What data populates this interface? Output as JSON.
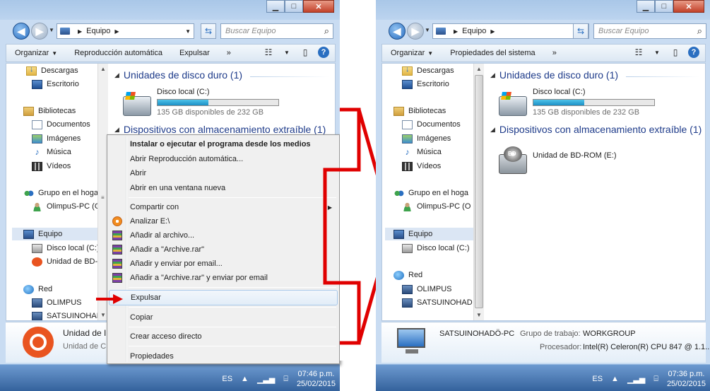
{
  "left_window": {
    "address": {
      "location": "Equipo"
    },
    "search_placeholder": "Buscar Equipo",
    "toolbar": {
      "organize": "Organizar",
      "autoplay": "Reproducción automática",
      "eject": "Expulsar",
      "more": "»"
    },
    "nav": {
      "downloads": "Descargas",
      "desktop": "Escritorio",
      "libraries": "Bibliotecas",
      "documents": "Documentos",
      "images": "Imágenes",
      "music": "Música",
      "videos": "Vídeos",
      "homegroup": "Grupo en el hoga",
      "user": "OlimpuS-PC (O",
      "computer": "Equipo",
      "local_disk": "Disco local (C:)",
      "bd_drive": "Unidad de BD-R",
      "network": "Red",
      "net1": "OLIMPUS",
      "net2": "SATSUINOHAD"
    },
    "groups": {
      "hard_disks": "Unidades de disco duro (1)",
      "removable": "Dispositivos con almacenamiento extraíble (1)"
    },
    "local_disk": {
      "name": "Disco local (C:)",
      "free": "135 GB disponibles de 232 GB",
      "used_fraction": 0.42
    },
    "details": {
      "name": "Unidad de I",
      "type": "Unidad de CI"
    },
    "context_menu": {
      "install": "Instalar o ejecutar el programa desde los medios",
      "autoplay": "Abrir Reproducción automática...",
      "open": "Abrir",
      "open_new": "Abrir en una ventana nueva",
      "share": "Compartir con",
      "scan": "Analizar E:\\",
      "add_archive": "Añadir al archivo...",
      "add_rar": "Añadir a \"Archive.rar\"",
      "add_email": "Añadir y enviar por email...",
      "add_rar_email": "Añadir a \"Archive.rar\" y enviar por email",
      "eject": "Expulsar",
      "copy": "Copiar",
      "shortcut": "Crear acceso directo",
      "properties": "Propiedades"
    },
    "tray": {
      "lang": "ES",
      "time": "07:46 p.m.",
      "date": "25/02/2015"
    }
  },
  "right_window": {
    "address": {
      "location": "Equipo"
    },
    "search_placeholder": "Buscar Equipo",
    "toolbar": {
      "organize": "Organizar",
      "properties": "Propiedades del sistema",
      "more": "»"
    },
    "nav": {
      "downloads": "Descargas",
      "desktop": "Escritorio",
      "libraries": "Bibliotecas",
      "documents": "Documentos",
      "images": "Imágenes",
      "music": "Música",
      "videos": "Vídeos",
      "homegroup": "Grupo en el hoga",
      "user": "OlimpuS-PC (O",
      "computer": "Equipo",
      "local_disk": "Disco local (C:)",
      "network": "Red",
      "net1": "OLIMPUS",
      "net2": "SATSUINOHAD"
    },
    "groups": {
      "hard_disks": "Unidades de disco duro (1)",
      "removable": "Dispositivos con almacenamiento extraíble (1)"
    },
    "local_disk": {
      "name": "Disco local (C:)",
      "free": "135 GB disponibles de 232 GB",
      "used_fraction": 0.42
    },
    "bd_drive": {
      "name": "Unidad de BD-ROM (E:)",
      "label": "BD"
    },
    "details": {
      "name": "SATSUINOHADÖ-PC",
      "workgroup_label": "Grupo de trabajo:",
      "workgroup": "WORKGROUP",
      "processor_label": "Procesador:",
      "processor": "Intel(R) Celeron(R) CPU 847 @ 1.1..."
    },
    "tray": {
      "lang": "ES",
      "time": "07:36 p.m.",
      "date": "25/02/2015"
    }
  },
  "colors": {
    "arrow": "#e00000",
    "accent": "#1e3b8a",
    "capacity_fill": "#1b8fc6"
  }
}
